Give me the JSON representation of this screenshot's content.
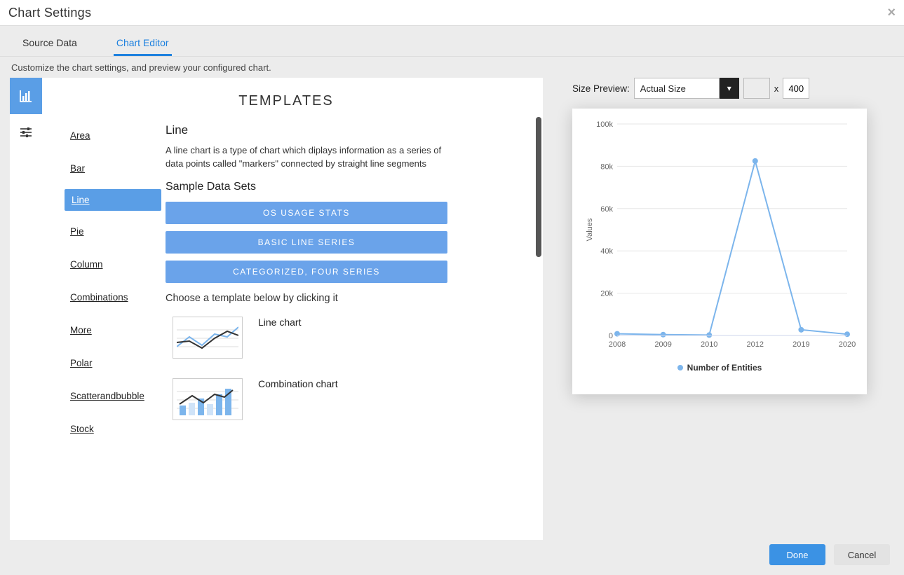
{
  "window": {
    "title": "Chart Settings"
  },
  "tabs": {
    "source_data": "Source Data",
    "chart_editor": "Chart Editor"
  },
  "subhead": "Customize the chart settings, and preview your configured chart.",
  "rail": {
    "chart": "chart-icon",
    "sliders": "settings-sliders-icon"
  },
  "templates": {
    "heading": "TEMPLATES",
    "categories": [
      "Area",
      "Bar",
      "Line",
      "Pie",
      "Column",
      "Combinations",
      "More",
      "Polar",
      "Scatterandbubble",
      "Stock"
    ],
    "selected_index": 2,
    "detail": {
      "title": "Line",
      "description": "A line chart is a type of chart which diplays information as a series of data points called \"markers\" connected by straight line segments",
      "datasets_label": "Sample Data Sets",
      "datasets": [
        "OS USAGE STATS",
        "BASIC LINE SERIES",
        "CATEGORIZED, FOUR SERIES"
      ],
      "choose_label": "Choose a template below by clicking it",
      "thumbs": [
        "Line chart",
        "Combination chart"
      ]
    }
  },
  "size_preview": {
    "label": "Size Preview:",
    "select_value": "Actual Size",
    "width": "",
    "height": "400"
  },
  "footer": {
    "done": "Done",
    "cancel": "Cancel"
  },
  "chart_data": {
    "type": "line",
    "ylabel": "Values",
    "categories": [
      "2008",
      "2009",
      "2010",
      "2012",
      "2019",
      "2020"
    ],
    "series": [
      {
        "name": "Number of Entities",
        "values": [
          800,
          400,
          200,
          82500,
          2700,
          600
        ]
      }
    ],
    "ylim": [
      0,
      100000
    ],
    "yticks": [
      0,
      20000,
      40000,
      60000,
      80000,
      100000
    ],
    "ytick_labels": [
      "0",
      "20k",
      "40k",
      "60k",
      "80k",
      "100k"
    ],
    "legend": "Number of Entities",
    "line_color": "#7cb5ec"
  }
}
